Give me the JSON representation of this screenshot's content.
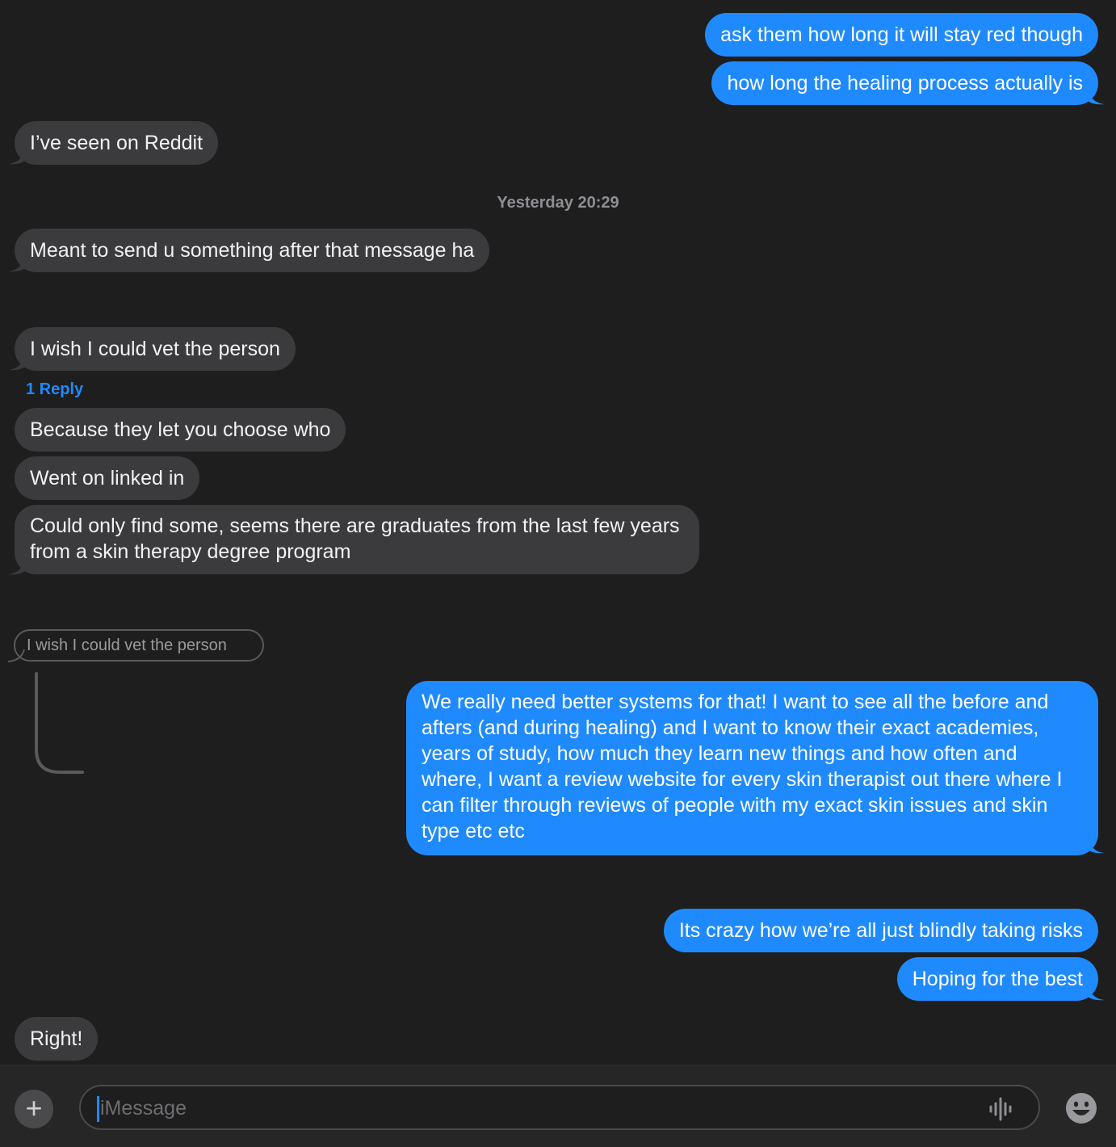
{
  "conversation": {
    "messages": [
      {
        "text": "ask them how long it will stay red though"
      },
      {
        "text": "how long the healing process actually is"
      },
      {
        "text": "I’ve seen on Reddit"
      },
      {
        "text": "Meant to send u something after that message ha"
      },
      {
        "text": "I wish I could vet the person"
      },
      {
        "text": "Because they let you choose who"
      },
      {
        "text": "Went on linked in"
      },
      {
        "text": "Could only find some, seems there are graduates from the last few years from a skin therapy degree program"
      },
      {
        "text": "We really need better systems for that! I want to see all the before and afters (and during healing) and I want to know their exact academies, years of study, how much they learn new things and how often and where, I want a review website for every skin therapist out there where I can filter through reviews of people with my exact skin issues and skin type etc etc"
      },
      {
        "text": "Its crazy how we’re all just blindly taking risks"
      },
      {
        "text": "Hoping for the best"
      },
      {
        "text": "Right!"
      }
    ],
    "timestamp": "Yesterday 20:29",
    "reply_count_label": "1 Reply",
    "quoted_reply": "I wish I could vet the person"
  },
  "composer": {
    "placeholder": "iMessage",
    "add_icon": "plus-icon",
    "audio_icon": "waveform-icon",
    "emoji_icon": "emoji-icon"
  },
  "colors": {
    "background": "#1e1e1e",
    "incoming_bubble": "#3b3b3d",
    "outgoing_bubble": "#1f8afe",
    "reply_link": "#1f8afe"
  }
}
